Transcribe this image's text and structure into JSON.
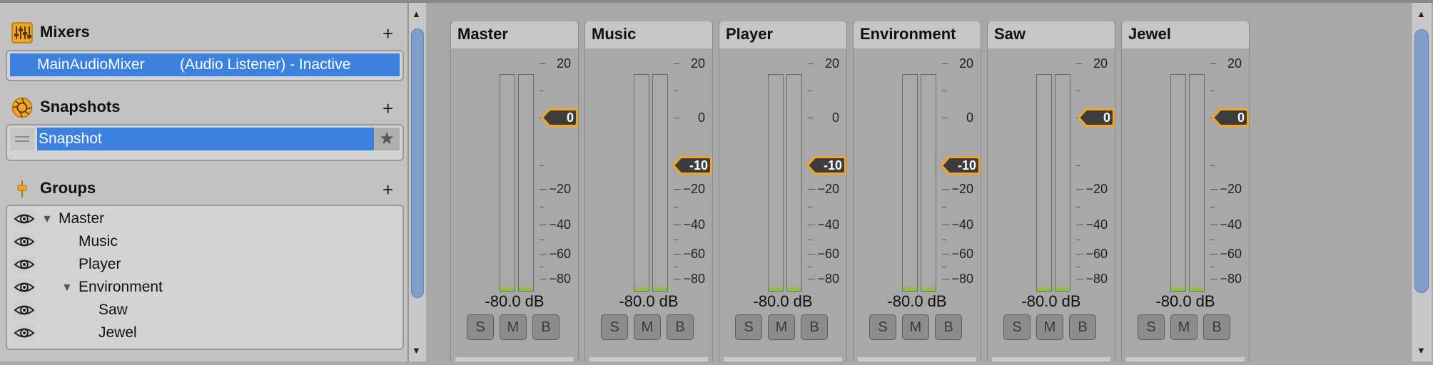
{
  "mixers": {
    "title": "Mixers",
    "add": "+",
    "item_name": "MainAudioMixer",
    "item_extra": "(Audio Listener) - Inactive"
  },
  "snapshots": {
    "title": "Snapshots",
    "add": "+",
    "item_name": "Snapshot",
    "star": "★"
  },
  "groups": {
    "title": "Groups",
    "add": "+",
    "items": [
      {
        "label": "Master",
        "expander": "▼"
      },
      {
        "label": "Music",
        "expander": ""
      },
      {
        "label": "Player",
        "expander": ""
      },
      {
        "label": "Environment",
        "expander": "▼"
      },
      {
        "label": "Saw",
        "expander": ""
      },
      {
        "label": "Jewel",
        "expander": ""
      }
    ]
  },
  "scale_labels": [
    "20",
    "0",
    "−20",
    "−40",
    "−60",
    "−80"
  ],
  "buttons": {
    "solo": "S",
    "mute": "M",
    "bypass": "B"
  },
  "strips": [
    {
      "name": "Master",
      "volume_db": 0,
      "volume_label": "0",
      "level": "-80.0 dB"
    },
    {
      "name": "Music",
      "volume_db": -10,
      "volume_label": "-10",
      "level": "-80.0 dB"
    },
    {
      "name": "Player",
      "volume_db": -10,
      "volume_label": "-10",
      "level": "-80.0 dB"
    },
    {
      "name": "Environment",
      "volume_db": -10,
      "volume_label": "-10",
      "level": "-80.0 dB"
    },
    {
      "name": "Saw",
      "volume_db": 0,
      "volume_label": "0",
      "level": "-80.0 dB"
    },
    {
      "name": "Jewel",
      "volume_db": 0,
      "volume_label": "0",
      "level": "-80.0 dB"
    }
  ],
  "colors": {
    "selection": "#3a81e0",
    "accent": "#f2a623",
    "meter_green": "#8cc242"
  },
  "icons": {
    "mixers": "mixer-icon",
    "snapshots": "snapshot-icon",
    "groups": "group-icon",
    "eye": "eye-icon"
  }
}
